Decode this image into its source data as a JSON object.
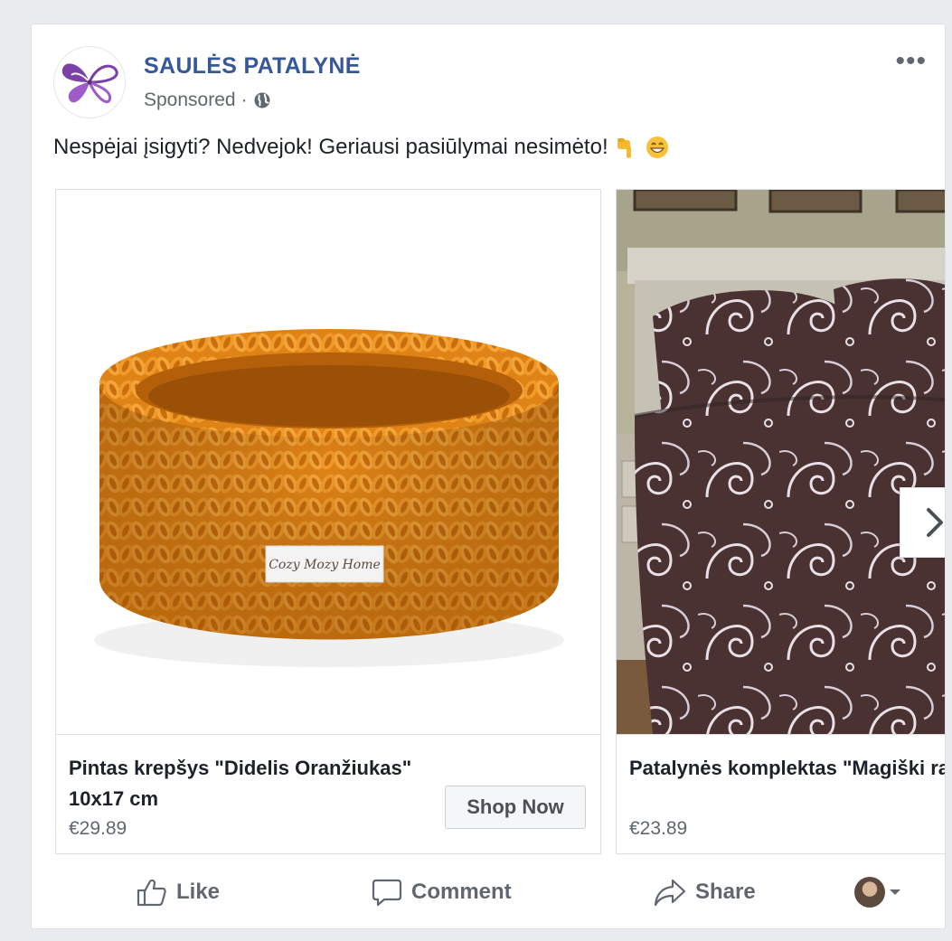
{
  "post": {
    "page_name": "SAULĖS PATALYNĖ",
    "sponsored_label": "Sponsored",
    "separator": "·",
    "privacy_icon": "globe-icon",
    "more_label": "•••",
    "text": "Nespėjai įsigyti? Nedvejok! Geriausi pasiūlymai nesimėto!",
    "emojis": [
      "point-down-emoji",
      "grinning-face-emoji"
    ]
  },
  "carousel": {
    "cards": [
      {
        "title": "Pintas krepšys \"Didelis Oranžiukas\" 10x17 cm",
        "price": "€29.89",
        "cta": "Shop Now",
        "label_text": "Cozy Mozy Home",
        "image": "orange-knitted-basket"
      },
      {
        "title": "Patalynės komplektas \"Magiški raštai\"",
        "price": "€23.89",
        "image": "brown-swirl-bedding"
      }
    ],
    "next_icon": "chevron-right-icon"
  },
  "actions": {
    "like": "Like",
    "comment": "Comment",
    "share": "Share"
  },
  "colors": {
    "page_background": "#e9ebee",
    "link_blue": "#365899",
    "secondary_text": "#606770",
    "primary_text": "#1d2129",
    "basket_orange": "#e9861a",
    "bedding_brown": "#4a3232"
  }
}
